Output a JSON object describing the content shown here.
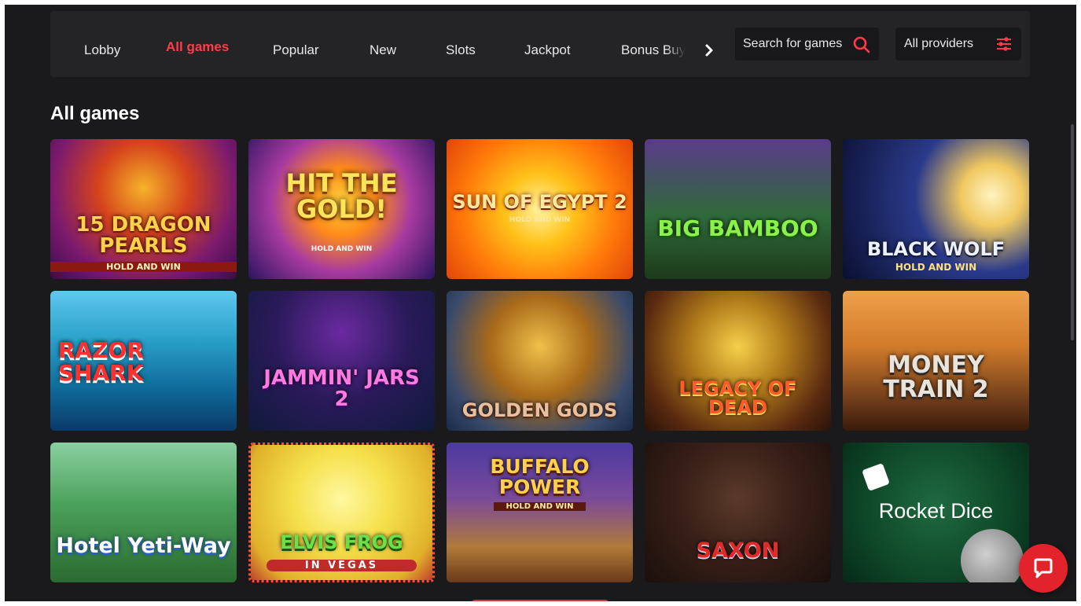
{
  "nav": {
    "tabs": [
      {
        "label": "Lobby",
        "active": false
      },
      {
        "label": "All games",
        "active": true
      },
      {
        "label": "Popular",
        "active": false
      },
      {
        "label": "New",
        "active": false
      },
      {
        "label": "Slots",
        "active": false
      },
      {
        "label": "Jackpot",
        "active": false
      },
      {
        "label": "Bonus Buy",
        "active": false
      }
    ],
    "more_icon": "chevron-right-icon",
    "search": {
      "placeholder": "Search for games",
      "value": "",
      "icon": "search-icon"
    },
    "providers": {
      "label": "All providers",
      "icon": "filter-sliders-icon"
    }
  },
  "section": {
    "title": "All games"
  },
  "games": [
    {
      "title": "15 DRAGON PEARLS",
      "subtitle": "HOLD AND WIN"
    },
    {
      "title": "HIT THE GOLD!",
      "subtitle": "HOLD AND WIN"
    },
    {
      "title": "SUN OF EGYPT 2",
      "subtitle": "HOLD AND WIN"
    },
    {
      "title": "BIG BAMBOO",
      "subtitle": ""
    },
    {
      "title": "BLACK WOLF",
      "subtitle": "HOLD AND WIN"
    },
    {
      "title": "RAZOR SHARK",
      "subtitle": ""
    },
    {
      "title": "JAMMIN' JARS 2",
      "subtitle": ""
    },
    {
      "title": "GOLDEN GODS",
      "subtitle": ""
    },
    {
      "title": "LEGACY OF DEAD",
      "subtitle": ""
    },
    {
      "title": "MONEY TRAIN 2",
      "subtitle": ""
    },
    {
      "title": "Hotel Yeti-Way",
      "subtitle": ""
    },
    {
      "title": "ELVIS FROG",
      "subtitle": "IN VEGAS"
    },
    {
      "title": "BUFFALO POWER",
      "subtitle": "HOLD AND WIN"
    },
    {
      "title": "SAXON",
      "subtitle": ""
    },
    {
      "title": "Rocket Dice",
      "subtitle": ""
    }
  ],
  "chat": {
    "icon": "chat-bubble-icon"
  },
  "colors": {
    "accent": "#ff3b4a",
    "background": "#1a1a1c",
    "navbar": "#242427",
    "chat": "#e3232c"
  }
}
